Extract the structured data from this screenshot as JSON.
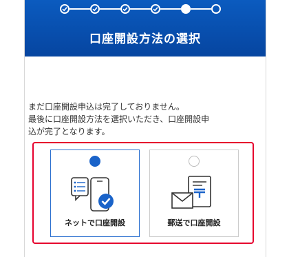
{
  "header": {
    "title": "口座開設方法の選択",
    "steps": [
      {
        "state": "done"
      },
      {
        "state": "done"
      },
      {
        "state": "done"
      },
      {
        "state": "done"
      },
      {
        "state": "current"
      },
      {
        "state": "upcoming"
      }
    ]
  },
  "message": {
    "line1": "まだ口座開設申込は完了しておりません。",
    "line2": "最後に口座開設方法を選択いただき、口座開設申",
    "line3": "込が完了となります。"
  },
  "options": [
    {
      "label": "ネットで口座開設",
      "selected": true,
      "icon": "smartphone-checklist-icon"
    },
    {
      "label": "郵送で口座開設",
      "selected": false,
      "icon": "mail-envelope-document-icon"
    }
  ],
  "colors": {
    "header_bg": "#0b5bbf",
    "accent": "#1a63c9",
    "highlight_border": "#e6002d"
  }
}
